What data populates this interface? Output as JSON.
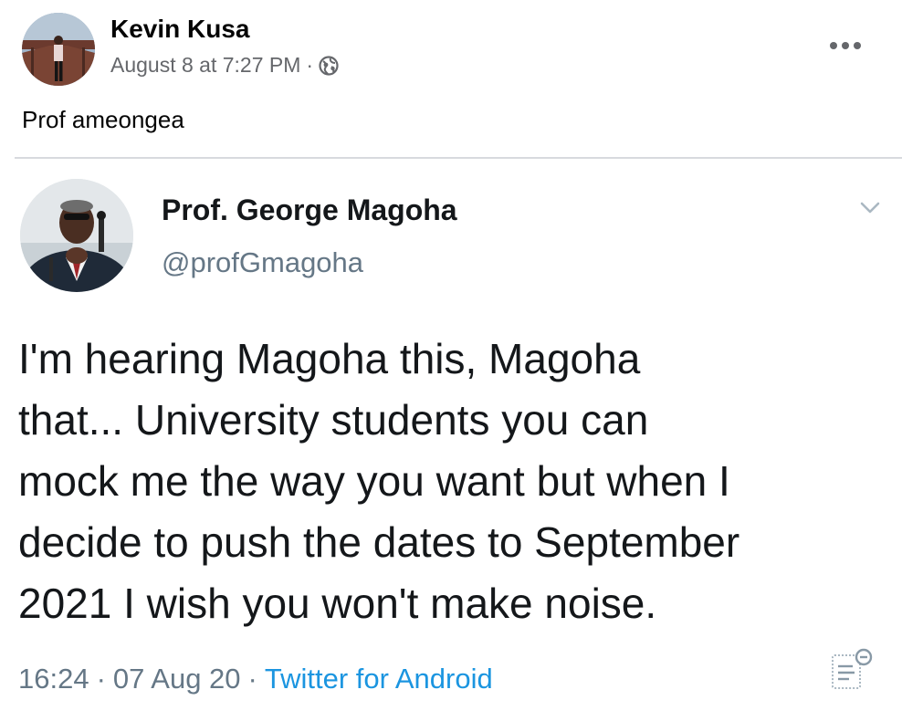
{
  "facebook_post": {
    "author": "Kevin Kusa",
    "timestamp": "August 8 at 7:27 PM",
    "separator": "·",
    "privacy_icon": "globe-icon",
    "more_icon": "more-dots-icon",
    "caption": "Prof ameongea"
  },
  "tweet": {
    "display_name": "Prof. George Magoha",
    "handle": "@profGmagoha",
    "menu_icon": "chevron-down-icon",
    "text_lines": [
      "I'm hearing Magoha this, Magoha",
      "that... University students you can",
      "mock me the way you want but when I",
      "decide to push the dates to September",
      "2021 I wish you won't make noise."
    ],
    "time": "16:24",
    "date": "07 Aug 20",
    "separator": "·",
    "source": "Twitter for Android",
    "analytics_icon": "analytics-icon"
  },
  "colors": {
    "fb_secondary_text": "#65676b",
    "twitter_secondary_text": "#657786",
    "twitter_link": "#1b95e0",
    "divider": "#d8dade"
  }
}
